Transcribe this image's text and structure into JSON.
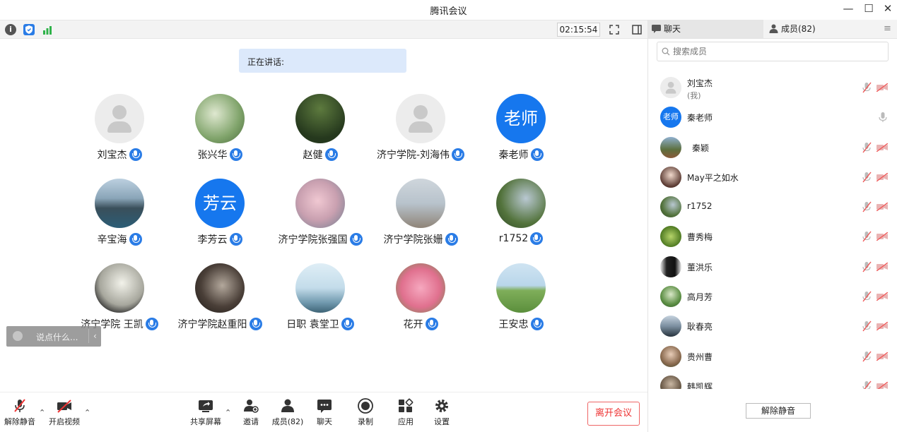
{
  "window": {
    "title": "腾讯会议"
  },
  "infobar": {
    "timer": "02:15:54"
  },
  "stage": {
    "speaking_label": "正在讲话:",
    "participants": [
      {
        "name": "刘宝杰",
        "avatar": "placeholder"
      },
      {
        "name": "张兴华",
        "avatar": "photo"
      },
      {
        "name": "赵健",
        "avatar": "photo"
      },
      {
        "name": "济宁学院-刘海伟",
        "avatar": "placeholder"
      },
      {
        "name": "秦老师",
        "avatar": "text",
        "avatar_text": "老师"
      },
      {
        "name": "辛宝海",
        "avatar": "photo"
      },
      {
        "name": "李芳云",
        "avatar": "text",
        "avatar_text": "芳云"
      },
      {
        "name": "济宁学院张强国",
        "avatar": "photo"
      },
      {
        "name": "济宁学院张姗",
        "avatar": "photo"
      },
      {
        "name": "r1752",
        "avatar": "photo"
      },
      {
        "name": "济宁学院 王凯",
        "avatar": "photo"
      },
      {
        "name": "济宁学院赵重阳",
        "avatar": "photo"
      },
      {
        "name": "日职 袁堂卫",
        "avatar": "photo"
      },
      {
        "name": "花开",
        "avatar": "photo"
      },
      {
        "name": "王安忠",
        "avatar": "photo"
      }
    ],
    "chat_placeholder": "说点什么..."
  },
  "toolbar": {
    "unmute": "解除静音",
    "start_video": "开启视频",
    "share_screen": "共享屏幕",
    "invite": "邀请",
    "members": "成员(82)",
    "chat": "聊天",
    "record": "录制",
    "apps": "应用",
    "settings": "设置",
    "leave": "离开会议"
  },
  "panel": {
    "tab_chat": "聊天",
    "tab_members": "成员(82)",
    "search_placeholder": "搜索成员",
    "members": [
      {
        "name": "刘宝杰",
        "sub": "(我)"
      },
      {
        "name": "秦老师",
        "avatar_text": "老师"
      },
      {
        "name": "秦颖"
      },
      {
        "name": "May平之如水"
      },
      {
        "name": "r1752"
      },
      {
        "name": "曹秀梅"
      },
      {
        "name": "董洪乐"
      },
      {
        "name": "高月芳"
      },
      {
        "name": "耿春亮"
      },
      {
        "name": "贵州曹"
      },
      {
        "name": "韩凯辉"
      }
    ],
    "unmute_all": "解除静音"
  }
}
